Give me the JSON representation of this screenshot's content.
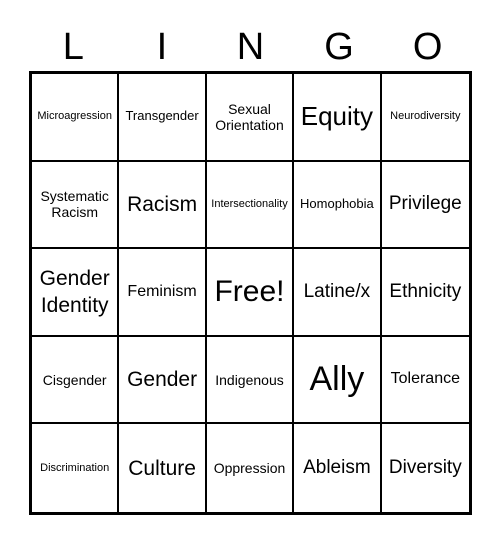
{
  "header": {
    "letters": [
      "L",
      "I",
      "N",
      "G",
      "O"
    ]
  },
  "board": {
    "rows": [
      [
        "Microagression",
        "Transgender",
        "Sexual Orientation",
        "Equity",
        "Neurodiversity"
      ],
      [
        "Systematic Racism",
        "Racism",
        "Intersectionality",
        "Homophobia",
        "Privilege"
      ],
      [
        "Gender Identity",
        "Feminism",
        "Free!",
        "Latine/x",
        "Ethnicity"
      ],
      [
        "Cisgender",
        "Gender",
        "Indigenous",
        "Ally",
        "Tolerance"
      ],
      [
        "Discrimination",
        "Culture",
        "Oppression",
        "Ableism",
        "Diversity"
      ]
    ]
  }
}
